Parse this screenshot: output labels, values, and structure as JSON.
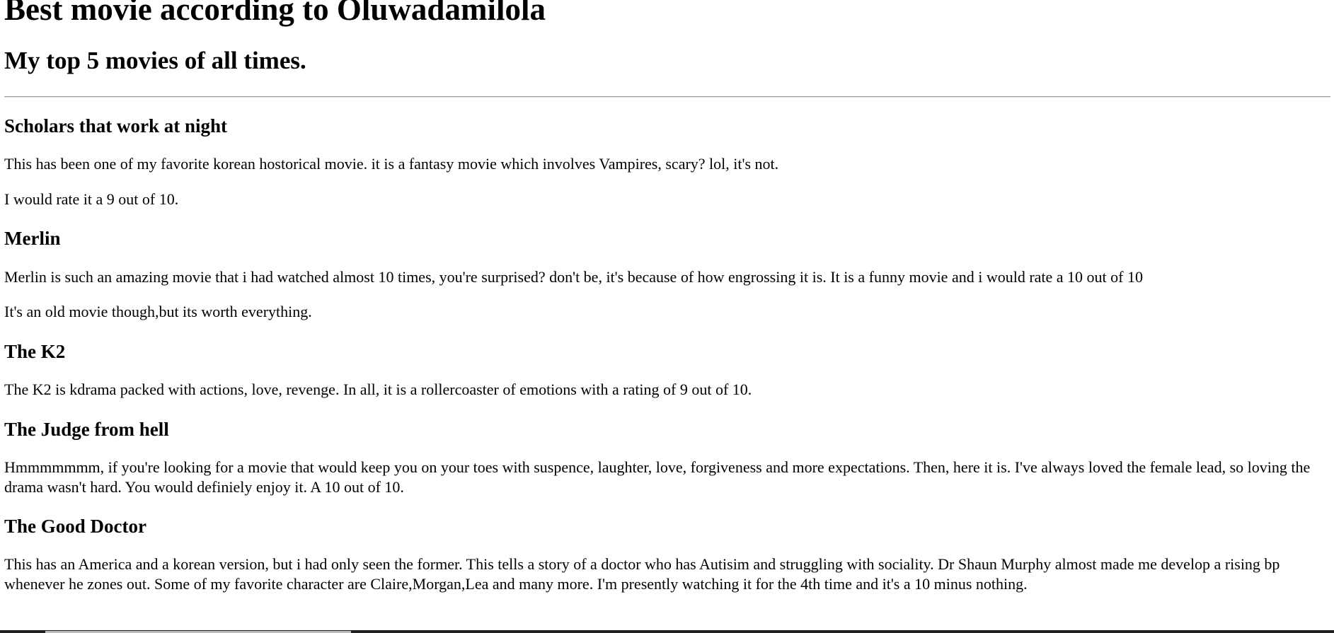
{
  "page": {
    "title": "Best movie according to Oluwadamilola",
    "subtitle": "My top 5 movies of all times."
  },
  "movies": [
    {
      "title": "Scholars that work at night",
      "paragraphs": [
        "This has been one of my favorite korean hostorical movie. it is a fantasy movie which involves Vampires, scary? lol, it's not.",
        "I would rate it a 9 out of 10."
      ]
    },
    {
      "title": "Merlin",
      "paragraphs": [
        "Merlin is such an amazing movie that i had watched almost 10 times, you're surprised? don't be, it's because of how engrossing it is. It is a funny movie and i would rate a 10 out of 10",
        "It's an old movie though,but its worth everything."
      ]
    },
    {
      "title": "The K2",
      "paragraphs": [
        "The K2 is kdrama packed with actions, love, revenge. In all, it is a rollercoaster of emotions with a rating of 9 out of 10."
      ]
    },
    {
      "title": "The Judge from hell",
      "paragraphs": [
        "Hmmmmmmm, if you're looking for a movie that would keep you on your toes with suspence, laughter, love, forgiveness and more expectations. Then, here it is. I've always loved the female lead, so loving the drama wasn't hard. You would definiely enjoy it. A 10 out of 10."
      ]
    },
    {
      "title": "The Good Doctor",
      "paragraphs": [
        "This has an America and a korean version, but i had only seen the former. This tells a story of a doctor who has Autisim and struggling with sociality. Dr Shaun Murphy almost made me develop a rising bp whenever he zones out. Some of my favorite character are Claire,Morgan,Lea and many more. I'm presently watching it for the 4th time and it's a 10 minus nothing."
      ]
    }
  ]
}
